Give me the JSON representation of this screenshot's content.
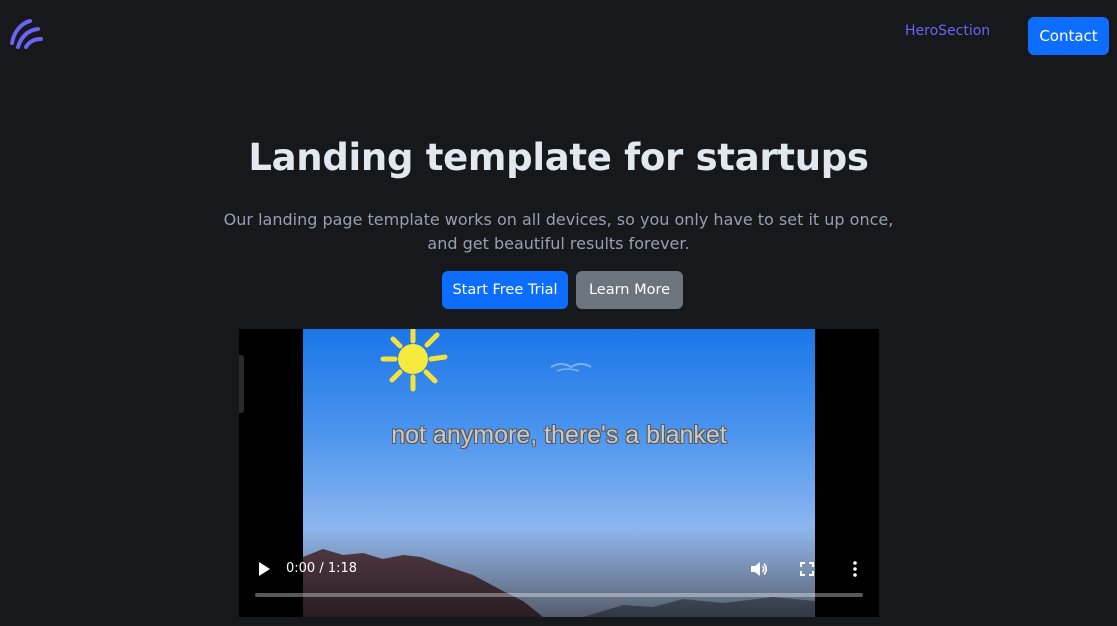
{
  "header": {
    "logo_icon": "brand-logo-icon",
    "nav_link": "HeroSection",
    "contact_label": "Contact",
    "accent_color": "#6d63f3",
    "button_color": "#0d6efd"
  },
  "hero": {
    "title": "Landing template for startups",
    "subtitle": "Our landing page template works on all devices, so you only have to set it up once, and get beautiful results forever.",
    "primary_cta": "Start Free Trial",
    "secondary_cta": "Learn More"
  },
  "video": {
    "caption": "not anymore, there's a blanket",
    "time": "0:00 / 1:18",
    "progress": 0,
    "icons": {
      "play": "play-icon",
      "volume": "volume-icon",
      "fullscreen": "fullscreen-icon",
      "more": "more-options-icon"
    }
  }
}
